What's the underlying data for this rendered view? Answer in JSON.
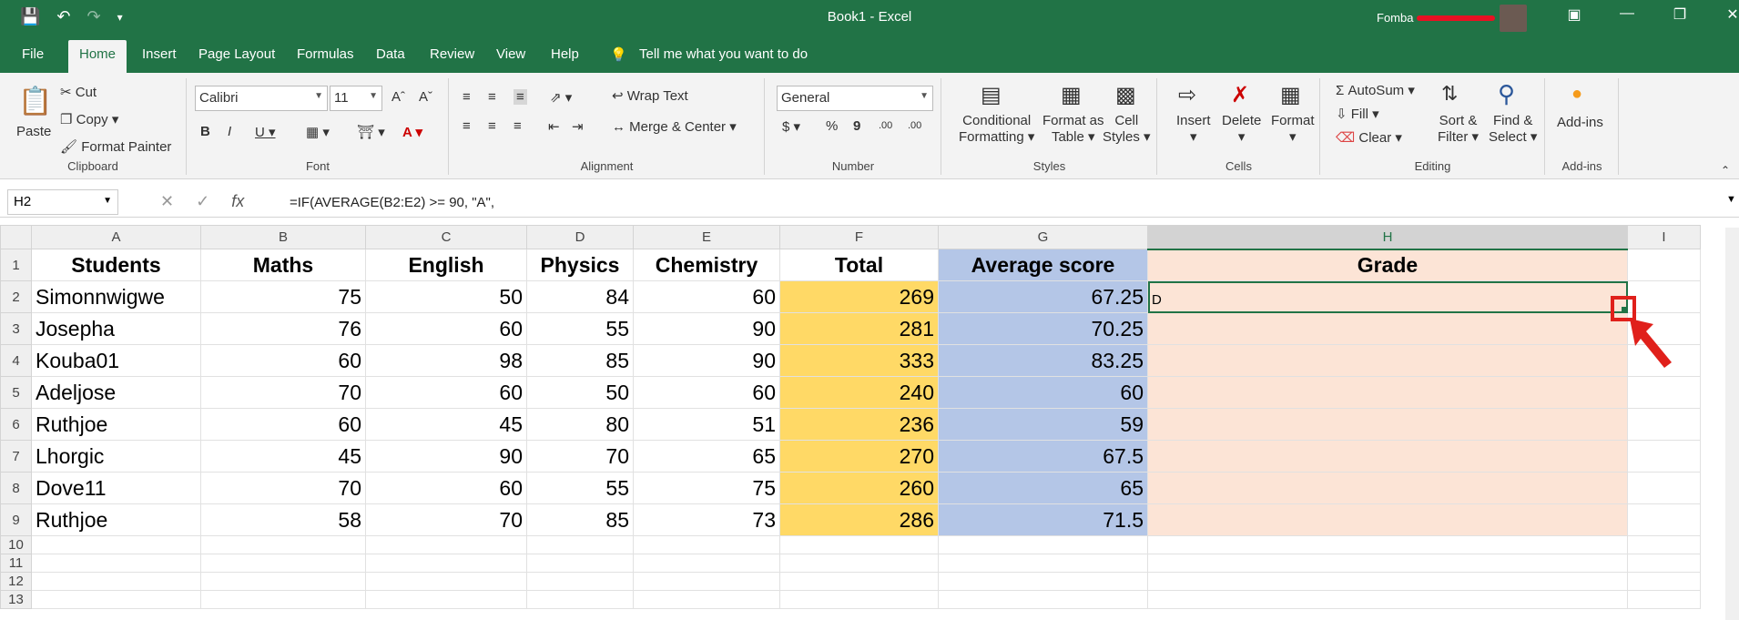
{
  "titlebar": {
    "title": "Book1  -  Excel",
    "user": "Fomba"
  },
  "menu": {
    "tabs": [
      "File",
      "Home",
      "Insert",
      "Page Layout",
      "Formulas",
      "Data",
      "Review",
      "View",
      "Help"
    ],
    "tell_me": "Tell me what you want to do"
  },
  "ribbon": {
    "clipboard": {
      "paste": "Paste",
      "cut": "Cut",
      "copy": "Copy",
      "format_painter": "Format Painter",
      "label": "Clipboard"
    },
    "font": {
      "name": "Calibri",
      "size": "11",
      "label": "Font"
    },
    "alignment": {
      "wrap": "Wrap Text",
      "merge": "Merge & Center",
      "label": "Alignment"
    },
    "number": {
      "format": "General",
      "label": "Number"
    },
    "styles": {
      "conditional": "Conditional",
      "conditional2": "Formatting",
      "format_table": "Format as",
      "format_table2": "Table",
      "cell_styles": "Cell",
      "cell_styles2": "Styles",
      "label": "Styles"
    },
    "cells": {
      "insert": "Insert",
      "delete": "Delete",
      "format": "Format",
      "label": "Cells"
    },
    "editing": {
      "autosum": "AutoSum",
      "fill": "Fill",
      "clear": "Clear",
      "sort": "Sort &",
      "sort2": "Filter",
      "find": "Find &",
      "find2": "Select",
      "label": "Editing"
    },
    "addins": {
      "addins": "Add-ins",
      "label": "Add-ins"
    }
  },
  "formula_bar": {
    "name_box": "H2",
    "formula": "=IF(AVERAGE(B2:E2) >= 90, \"A\","
  },
  "sheet": {
    "columns": [
      "A",
      "B",
      "C",
      "D",
      "E",
      "F",
      "G",
      "H",
      "I"
    ],
    "header_row": [
      "Students",
      "Maths",
      "English",
      "Physics",
      "Chemistry",
      "Total",
      "Average score",
      "Grade"
    ],
    "rows": [
      [
        "Simonnwigwe",
        "75",
        "50",
        "84",
        "60",
        "269",
        "67.25",
        "D"
      ],
      [
        "Josepha",
        "76",
        "60",
        "55",
        "90",
        "281",
        "70.25",
        ""
      ],
      [
        "Kouba01",
        "60",
        "98",
        "85",
        "90",
        "333",
        "83.25",
        ""
      ],
      [
        "Adeljose",
        "70",
        "60",
        "50",
        "60",
        "240",
        "60",
        ""
      ],
      [
        "Ruthjoe",
        "60",
        "45",
        "80",
        "51",
        "236",
        "59",
        ""
      ],
      [
        "Lhorgic",
        "45",
        "90",
        "70",
        "65",
        "270",
        "67.5",
        ""
      ],
      [
        "Dove11",
        "70",
        "60",
        "55",
        "75",
        "260",
        "65",
        ""
      ],
      [
        "Ruthjoe",
        "58",
        "70",
        "85",
        "73",
        "286",
        "71.5",
        ""
      ]
    ],
    "row_numbers": [
      "1",
      "2",
      "3",
      "4",
      "5",
      "6",
      "7",
      "8",
      "9",
      "10",
      "11",
      "12",
      "13"
    ],
    "colors": {
      "total": "#ffd966",
      "average": "#b4c6e7",
      "grade": "#fce4d6",
      "accent": "#217346",
      "callout": "#e0201b"
    }
  }
}
